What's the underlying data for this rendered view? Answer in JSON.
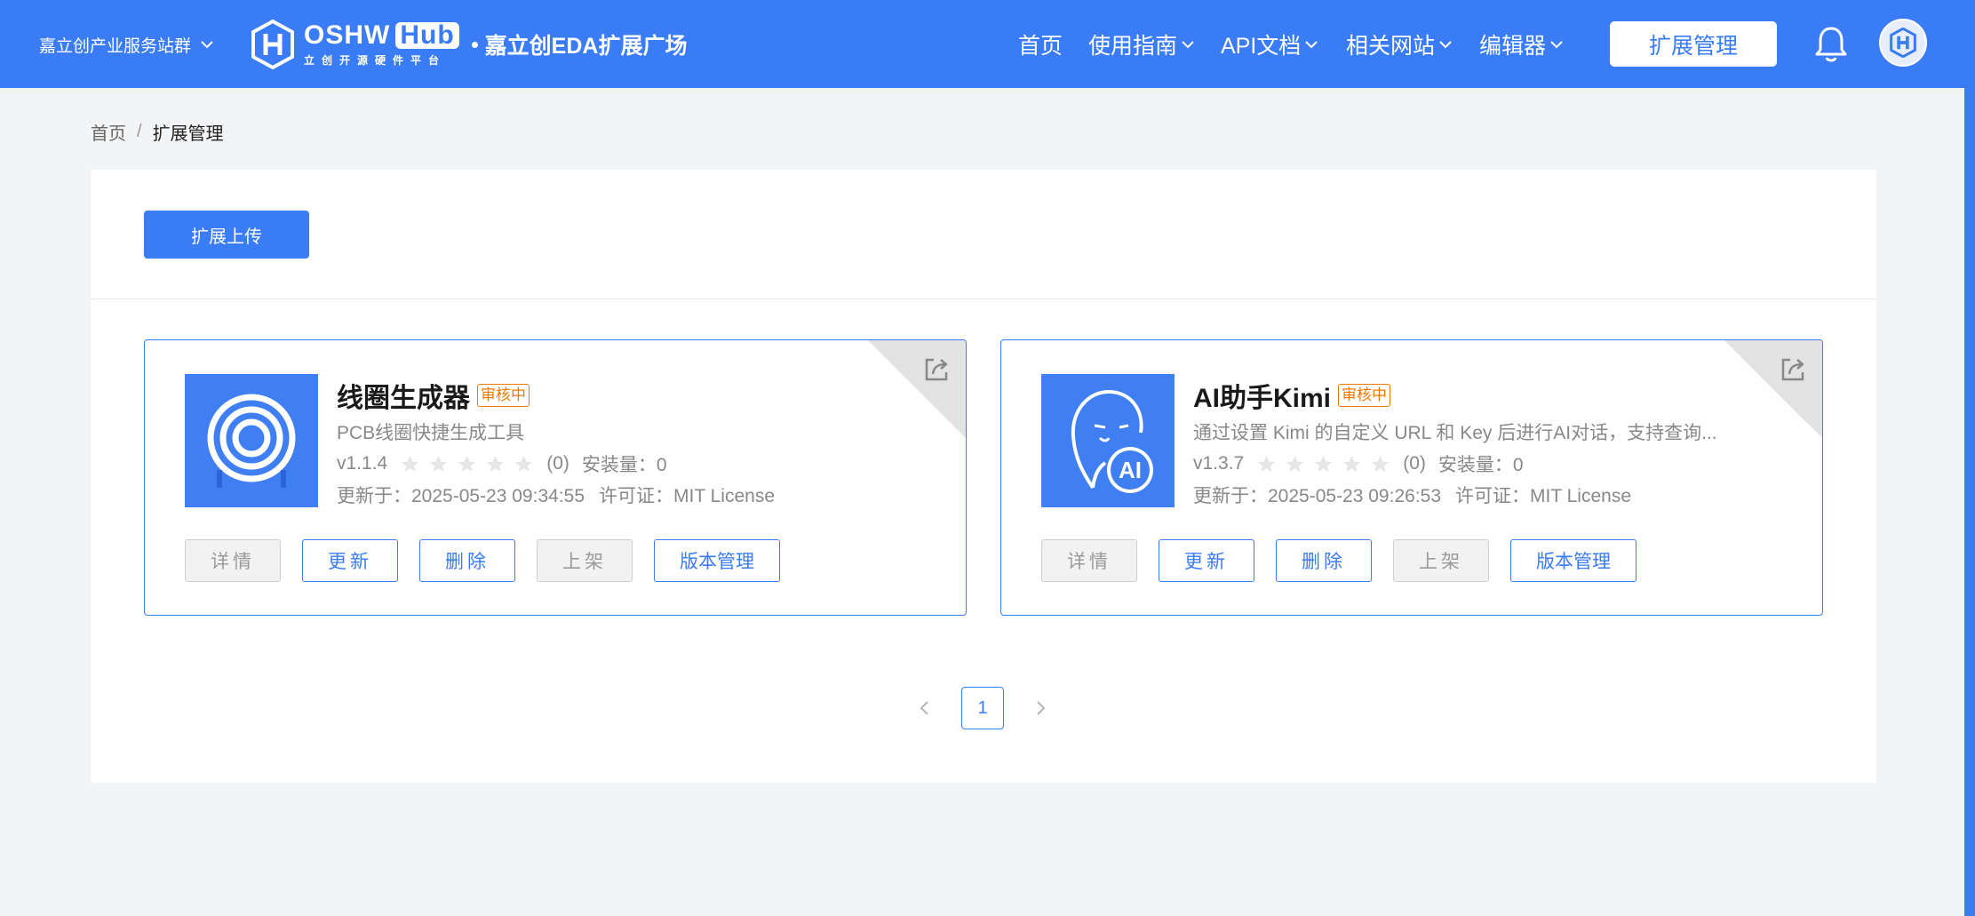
{
  "header": {
    "site_switch": "嘉立创产业服务站群",
    "logo": {
      "brand": "OSHW",
      "hub": "Hub",
      "subtitle": "立创开源硬件平台",
      "tagline": "嘉立创EDA扩展广场"
    },
    "nav": [
      {
        "label": "首页",
        "has_dropdown": false
      },
      {
        "label": "使用指南",
        "has_dropdown": true
      },
      {
        "label": "API文档",
        "has_dropdown": true
      },
      {
        "label": "相关网站",
        "has_dropdown": true
      },
      {
        "label": "编辑器",
        "has_dropdown": true
      }
    ],
    "manage_button": "扩展管理",
    "colors": {
      "primary": "#3a7cf6",
      "pending": "#f07800"
    }
  },
  "breadcrumb": {
    "home": "首页",
    "separator": "/",
    "current": "扩展管理"
  },
  "toolbar": {
    "upload_label": "扩展上传"
  },
  "extensions": [
    {
      "icon": "concentric-coil-icon",
      "title": "线圈生成器",
      "status": "审核中",
      "description": "PCB线圈快捷生成工具",
      "version": "v1.1.4",
      "rating_count": "(0)",
      "installs": "安装量：0",
      "rating": 0,
      "updated": "更新于：2025-05-23 09:34:55",
      "license": "许可证：MIT License",
      "actions": {
        "detail": "详情",
        "update": "更新",
        "delete": "删除",
        "publish": "上架",
        "versions": "版本管理"
      }
    },
    {
      "icon": "kimi-ai-face-icon",
      "title": "AI助手Kimi",
      "status": "审核中",
      "description": "通过设置 Kimi 的自定义 URL 和 Key 后进行AI对话，支持查询...",
      "version": "v1.3.7",
      "rating_count": "(0)",
      "installs": "安装量：0",
      "rating": 0,
      "updated": "更新于：2025-05-23 09:26:53",
      "license": "许可证：MIT License",
      "actions": {
        "detail": "详情",
        "update": "更新",
        "delete": "删除",
        "publish": "上架",
        "versions": "版本管理"
      }
    }
  ],
  "pagination": {
    "current": "1"
  }
}
